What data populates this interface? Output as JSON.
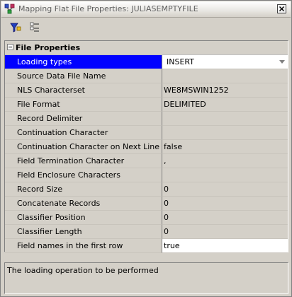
{
  "window": {
    "title": "Mapping Flat File Properties: JULIASEMPTYFILE",
    "close_label": "X"
  },
  "toolbar": {
    "buttons": [
      {
        "name": "filter-properties-icon"
      },
      {
        "name": "categorize-properties-icon"
      }
    ]
  },
  "grid": {
    "category": "File Properties",
    "properties": [
      {
        "name": "Loading types",
        "value": "INSERT",
        "selected": true,
        "dropdown": true
      },
      {
        "name": "Source Data File Name",
        "value": ""
      },
      {
        "name": "NLS Characterset",
        "value": "WE8MSWIN1252"
      },
      {
        "name": "File Format",
        "value": "DELIMITED"
      },
      {
        "name": "Record Delimiter",
        "value": ""
      },
      {
        "name": "Continuation Character",
        "value": ""
      },
      {
        "name": "Continuation Character on Next Line",
        "value": "false"
      },
      {
        "name": "Field Termination Character",
        "value": ","
      },
      {
        "name": "Field Enclosure Characters",
        "value": ""
      },
      {
        "name": "Record Size",
        "value": "0"
      },
      {
        "name": "Concatenate Records",
        "value": "0"
      },
      {
        "name": "Classifier Position",
        "value": "0"
      },
      {
        "name": "Classifier Length",
        "value": "0"
      },
      {
        "name": "Field names in the first row",
        "value": "true",
        "editing": true
      }
    ]
  },
  "description": {
    "text": "The loading operation to be performed"
  },
  "colors": {
    "selection": "#0000ff",
    "panel": "#d4d0c8"
  }
}
